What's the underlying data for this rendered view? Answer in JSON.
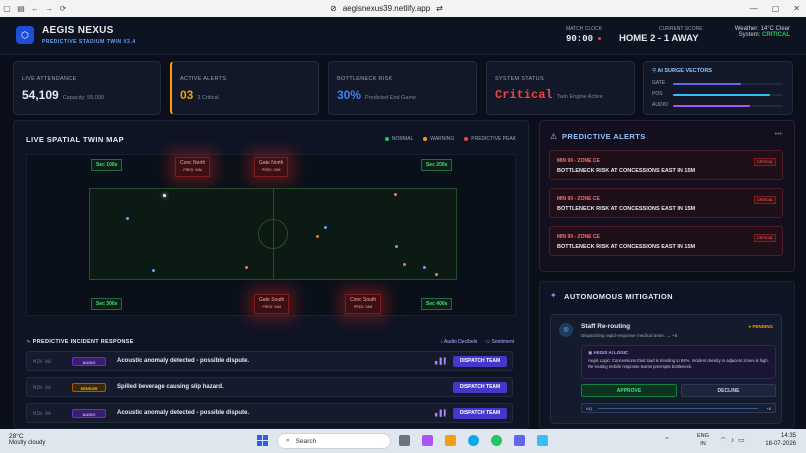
{
  "browser": {
    "url": "aegisnexus39.netlify.app",
    "back_icon": "←",
    "forward_icon": "→",
    "reload_icon": "⟳"
  },
  "header": {
    "app_name": "AEGIS NEXUS",
    "app_subtitle": "PREDICTIVE STADIUM TWIN V2.4",
    "logo_glyph": "⬡",
    "match_clock_label": "MATCH CLOCK",
    "match_clock": "90:00",
    "score_label": "CURRENT SCORE",
    "score": "HOME 2 - 1 AWAY",
    "weather": "Weather: 14°C Clear",
    "system_prefix": "System:",
    "system_state": "CRITICAL"
  },
  "stats": {
    "attendance_label": "LIVE ATTENDANCE",
    "attendance_value": "54,109",
    "attendance_sub": "Capacity: 55,000",
    "alerts_label": "ACTIVE ALERTS",
    "alerts_value": "03",
    "alerts_sub": "3 Critical",
    "risk_label": "BOTTLENECK RISK",
    "risk_value": "30%",
    "risk_sub": "Predicted End Game",
    "status_label": "SYSTEM STATUS",
    "status_value": "Critical",
    "status_sub": "Twin Engine Active"
  },
  "surge": {
    "title": "AI SURGE VECTORS",
    "rows": [
      {
        "label": "GATE",
        "level": 0.62,
        "color": "#6366f1"
      },
      {
        "label": "POS",
        "level": 0.88,
        "color": "#38bdf8"
      },
      {
        "label": "AUDIO",
        "level": 0.7,
        "color": "#a855f7"
      }
    ]
  },
  "map": {
    "title": "LIVE SPATIAL TWIN MAP",
    "legend": [
      {
        "label": "NORMAL",
        "color": "#22c55e"
      },
      {
        "label": "WARNING",
        "color": "#f59e0b"
      },
      {
        "label": "PREDICTIVE PEAK",
        "color": "#ef4444"
      }
    ],
    "sec_tl": "Sec 100s",
    "sec_tr": "Sec 200s",
    "sec_bl": "Sec 300s",
    "sec_br": "Sec 400s",
    "conc_north": "Conc North",
    "gate_north": "Gate North",
    "gate_south": "Gate South",
    "conc_south": "Conc South",
    "pred_tag": "PRED: 34M"
  },
  "incidents": {
    "title": "PREDICTIVE INCIDENT RESPONSE",
    "audio_link": "Audio Decibels",
    "sentiment_link": "Sentiment",
    "dispatch_label": "DISPATCH TEAM",
    "rows": [
      {
        "min": "MIN 90",
        "tag": "AUDIO",
        "text": "Acoustic anomaly detected - possible dispute."
      },
      {
        "min": "MIN 90",
        "tag": "SENSOR",
        "text": "Spilled beverage causing slip hazard."
      },
      {
        "min": "MIN 90",
        "tag": "AUDIO",
        "text": "Acoustic anomaly detected - possible dispute."
      }
    ]
  },
  "alerts": {
    "title": "PREDICTIVE ALERTS",
    "items": [
      {
        "zone": "MIN 90 - ZONE CE",
        "badge": "CRITICAL",
        "message": "BOTTLENECK RISK AT CONCESSIONS EAST IN 15M"
      },
      {
        "zone": "MIN 90 - ZONE CE",
        "badge": "CRITICAL",
        "message": "BOTTLENECK RISK AT CONCESSIONS EAST IN 15M"
      },
      {
        "zone": "MIN 90 - ZONE CE",
        "badge": "CRITICAL",
        "message": "BOTTLENECK RISK AT CONCESSIONS EAST IN 15M"
      }
    ]
  },
  "mitigation": {
    "title": "AUTONOMOUS MITIGATION",
    "card_title": "Staff Re-routing",
    "card_desc": "Dispatching rapid-response medical team. → +8",
    "status": "● PENDING",
    "logic_title": "AEGIS AI LOGIC",
    "logic_text": "Aegis Logic: Concessions East load is trending to 84%. Incident density in adjacent zones is high. Re-routing mobile response teams preempts bottleneck.",
    "approve_label": "APPROVE",
    "decline_label": "DECLINE",
    "track_left": "HQ",
    "track_right": "+8"
  },
  "taskbar": {
    "temp": "28°C",
    "condition": "Mostly cloudy",
    "search_placeholder": "Search",
    "lang_1": "ENG",
    "lang_2": "IN",
    "time": "14:35",
    "date": "18-07-2026",
    "notif_count": "3"
  }
}
